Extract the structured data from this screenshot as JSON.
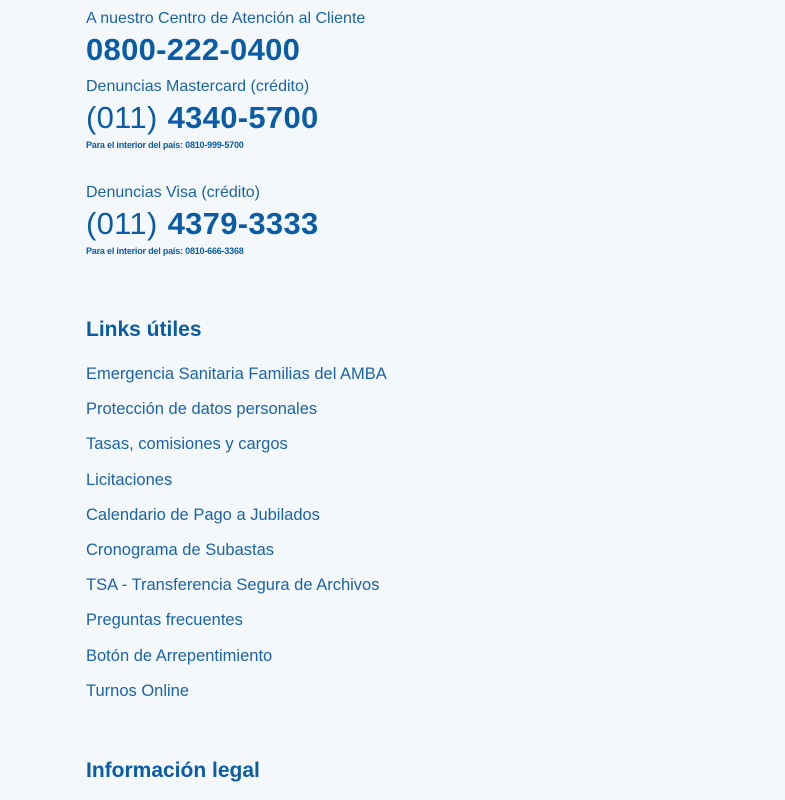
{
  "contact": {
    "customer_center_label": "A nuestro Centro de Atención al Cliente",
    "customer_center_phone": "0800-222-0400",
    "mastercard": {
      "label": "Denuncias Mastercard (crédito)",
      "area": "(011)",
      "number": "4340-5700",
      "interior": "Para el interior del país: 0810-999-5700"
    },
    "visa": {
      "label": "Denuncias Visa (crédito)",
      "area": "(011)",
      "number": "4379-3333",
      "interior": "Para el interior del país: 0810-666-3368"
    }
  },
  "useful_links": {
    "heading": "Links útiles",
    "items": [
      "Emergencia Sanitaria Familias del AMBA",
      "Protección de datos personales",
      "Tasas, comisiones y cargos",
      "Licitaciones",
      "Calendario de Pago a Jubilados",
      "Cronograma de Subastas",
      "TSA - Transferencia Segura de Archivos",
      "Preguntas frecuentes",
      "Botón de Arrepentimiento",
      "Turnos Online"
    ]
  },
  "legal": {
    "heading": "Información legal"
  }
}
